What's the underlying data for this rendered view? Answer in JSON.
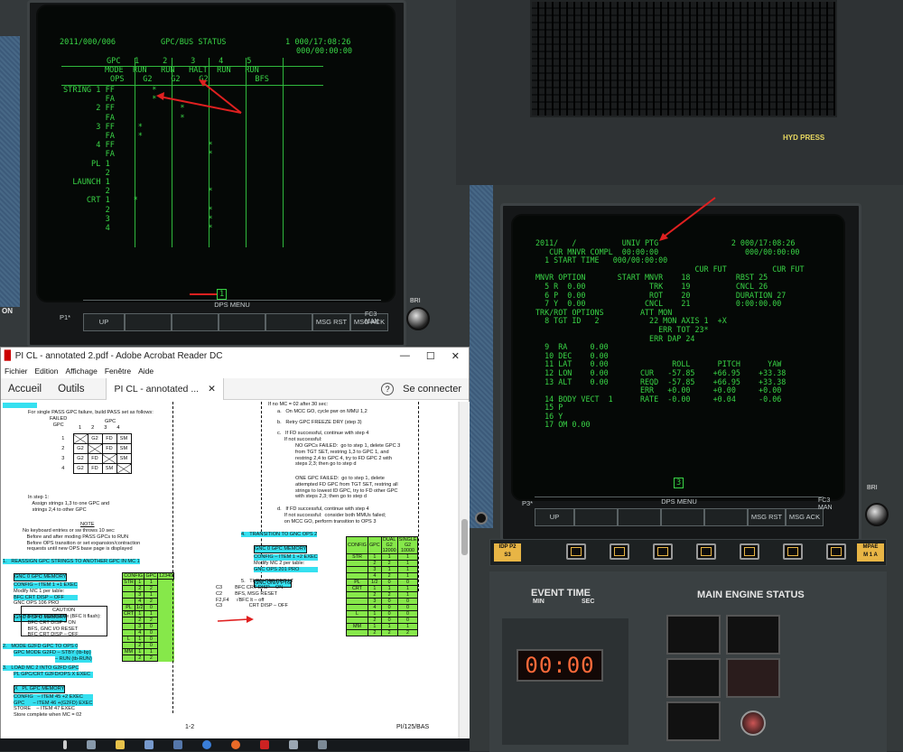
{
  "left_crt": {
    "header_left": "2011/000/006",
    "header_title": "GPC/BUS STATUS",
    "header_right_1": "1 000/17:08:26",
    "header_right_2": "000/00:00:00",
    "gpc_row": "GPC   1     2     3     4     5",
    "mode_row": "MODE  RUN   RUN   HALT  RUN   RUN",
    "ops_row": "OPS    G2    G2    G2          BFS",
    "string_rows": [
      "STRING 1 FF        *",
      "         FA        *",
      "       2 FF              *",
      "         FA              *",
      "       3 FF     *",
      "         FA     *",
      "       4 FF                    *",
      "         FA                    *",
      "",
      "      PL 1",
      "         2",
      "  LAUNCH 1",
      "         2                     *",
      "     CRT 1     *",
      "         2                     *",
      "         3                     *",
      "         4                     *"
    ],
    "page_num": "1",
    "dps_menu": "DPS MENU",
    "p1_label": "P1*",
    "fc_label": "FC3",
    "man_label": "MAN",
    "softkeys": [
      "UP",
      "",
      "",
      "",
      "",
      "MSG RST",
      "MSG ACK"
    ]
  },
  "right_crt": {
    "lines": [
      "2011/   /          UNIV PTG                2 000/17:08:26",
      "   CUR MNVR COMPL  00:00:00                   000/00:00:00",
      "  1 START TIME   000/00:00:00",
      "                                   CUR FUT          CUR FUT",
      "MNVR OPTION       START MNVR    18          RBST 25",
      "  5 R  0.00              TRK    19          CNCL 26",
      "  6 P  0.00              ROT    20          DURATION 27",
      "  7 Y  0.00             CNCL    21          0:00:00.00",
      "",
      "TRK/ROT OPTIONS        ATT MON",
      "  8 TGT ID   2           22 MON AXIS 1  +X",
      "                           ERR TOT 23*",
      "                         ERR DAP 24",
      "  9  RA     0.00",
      "  10 DEC    0.00",
      "  11 LAT    0.00              ROLL      PITCH      YAW",
      "  12 LON    0.00       CUR   -57.85    +66.95    +33.38",
      "  13 ALT    0.00       REQD  -57.85    +66.95    +33.38",
      "                       ERR   +0.00     +0.00     +0.00",
      "  14 BODY VECT  1      RATE  -0.00     +0.04     -0.06",
      "",
      "  15 P",
      "  16 Y",
      "  17 OM 0.00"
    ],
    "page_num": "3",
    "dps_menu": "DPS MENU",
    "p3_label": "P3*",
    "fc_label": "FC3",
    "man_label": "MAN",
    "softkeys": [
      "UP",
      "",
      "",
      "",
      "",
      "MSG RST",
      "MSG ACK"
    ]
  },
  "panel_labels": {
    "hyd_press": "HYD PRESS",
    "bri_top": "BRI",
    "bri_bottom": "BRI",
    "on_label": "ON",
    "idp_label": "IDP P2",
    "idp_sub": "S3",
    "mpa_label": "MPAE",
    "mpa_sub": "M 1 A",
    "event_time": "EVENT TIME",
    "event_min": "MIN",
    "event_sec": "SEC",
    "main_engine_status": "MAIN ENGINE STATUS",
    "timer_value": "00:00"
  },
  "acrobat": {
    "title": "PI CL - annotated 2.pdf - Adobe Acrobat Reader DC",
    "menu": [
      "Fichier",
      "Edition",
      "Affichage",
      "Fenêtre",
      "Aide"
    ],
    "tab_home": "Accueil",
    "tab_tools": "Outils",
    "tab_doc": "PI CL - annotated ...",
    "help_icon_label": "?",
    "connect": "Se connecter",
    "page_footer_center": "1-2",
    "page_footer_right": "PI/125/BAS",
    "left_col": {
      "intro": "For single PASS GPC failure, build PASS set as follows:",
      "failed_gpc": "FAILED\nGPC",
      "gpc_header": "GPC",
      "gpc_cols": [
        "1",
        "2",
        "3",
        "4"
      ],
      "gpc_table": [
        [
          "1",
          "X",
          "G2",
          "FD",
          "SM"
        ],
        [
          "2",
          "G2",
          "X",
          "FD",
          "SM"
        ],
        [
          "3",
          "G2",
          "FD",
          "X",
          "SM"
        ],
        [
          "4",
          "G2",
          "FD",
          "SM",
          "X"
        ]
      ],
      "step1": "In step 1:\n   Assign strings 1,3 to one GPC and\n   strings 2,4 to other GPC",
      "note_title": "NOTE",
      "note_body": "No keyboard entries or sw throws 10 sec:\n   Before and after moding PASS GPCs to RUN\n   Before OPS transition or set expansion/contraction\n   requests until new OPS base page is displayed",
      "s1_title": "1.   REASSIGN GPC STRINGS TO ANOTHER GPC IN MC 1",
      "s1_lines": [
        "GNC 0 GPC MEMORY",
        "CONFIG – ITEM 1 +1 EXEC",
        "Modify MC 1 per table:",
        "BFC CRT DISP – OFF",
        "GNC OPS 106 PRO",
        "GNC 0 GPC MEMORY"
      ],
      "caution_title": "CAUTION",
      "caution_body": "If BFS is standalone (BFC lt flash):\n   BFC CRT DISP – ON\n   BFS, GNC I/O RESET\n   BFC CRT DISP – OFF",
      "s2_title": "2.   MODE G2FD GPC TO OPS 0",
      "s2_lines": [
        "GPC MODE G2FD – STBY (tb-bp)",
        "– RUN (tb-RUN)"
      ],
      "s3_title": "3.   LOAD MC 2 INTO G2FD GPC",
      "s3_lines": [
        "PL GPC/CRT G2FD/OPS X EXEC",
        "X   PL GPC MEMORY",
        "CONFIG   – ITEM 45 +2 EXEC",
        "GPC      – ITEM 46 +(G2FD) EXEC",
        "STORE    – ITEM 47 EXEC",
        "Store complete when MC = 02"
      ],
      "cfg1_header": [
        "CONFIG",
        "GPC",
        "12340"
      ],
      "cfg_rows": [
        [
          "STR",
          "1",
          "1"
        ],
        [
          "",
          "2",
          "2"
        ],
        [
          "",
          "3",
          "1"
        ],
        [
          "",
          "4",
          "2"
        ],
        [
          "PL",
          "1/2",
          "0"
        ],
        [
          "CRT",
          "1",
          "1"
        ],
        [
          "",
          "2",
          "2"
        ],
        [
          "",
          "3",
          "0"
        ],
        [
          "",
          "4",
          "0"
        ],
        [
          "L",
          "1",
          "0"
        ],
        [
          "",
          "2",
          "0"
        ],
        [
          "MM",
          "1",
          "1"
        ],
        [
          "",
          "2",
          "2"
        ]
      ]
    },
    "right_col": {
      "intro": "If no MC = 02 after 30 sec:",
      "a": "a.   On MCC GO, cycle pwr on MMU 1,2",
      "b": "b.   Retry GPC FREEZE DRY (step 3)",
      "c": "c.   If FD successful, continue with step 4\n     If not successful:",
      "c1": "NO GPCs FAILED:  go to step 1, delete GPC 3\nfrom TGT SET, restring 1,3 to GPC 1, and\nrestring 2,4 to GPC 4, try to FD GPC 2 with\nsteps 2,3; then go to step d",
      "c2": "ONE GPC FAILED:  go to step 1, delete\nattempted FD GPC from TGT SET, restring all\nstrings to lowest ID GPC, try to FD other GPC\nwith steps 2,3; then go to step d",
      "d": "d.   If FD successful, continue with step 4\n     If not successful:  consider both MMUs failed;\n     on MCC GO, perform transition to OPS 3",
      "s4_title": "4.   TRANSITION TO GNC OPS 2",
      "s4_lines": [
        "GNC 0 GPC MEMORY",
        "CONFIG – ITEM 1 +2 EXEC",
        "Modify MC 2 per table:",
        "GNC OPS 201 PRO",
        "GNC UNIV PTG"
      ],
      "s5_title": "5.   TURN OFF BFC LT",
      "s5_body": "C3         BFC CRT DISP – ON\nC2         BFS, MSG RESET\nF2,F4     √BFC lt – off\nC3                   CRT DISP – OFF",
      "cfg2_header": [
        "CONFIG",
        "GPC",
        "DUAL\nG2\n12000",
        "SINGLE\nG2\n10000"
      ],
      "cfg2_rows": [
        [
          "STR",
          "1",
          "1",
          "1"
        ],
        [
          "",
          "2",
          "2",
          "1"
        ],
        [
          "",
          "3",
          "1",
          "1"
        ],
        [
          "",
          "4",
          "2",
          "1"
        ],
        [
          "PL",
          "1/2",
          "0",
          "0"
        ],
        [
          "CRT",
          "1",
          "1",
          "1"
        ],
        [
          "",
          "2",
          "2",
          "1"
        ],
        [
          "",
          "3",
          "0",
          "0"
        ],
        [
          "",
          "4",
          "0",
          "0"
        ],
        [
          "L",
          "1",
          "0",
          "0"
        ],
        [
          "",
          "2",
          "0",
          "0"
        ],
        [
          "MM",
          "1",
          "1",
          "1"
        ],
        [
          "",
          "2",
          "2",
          "2"
        ]
      ]
    }
  },
  "colors": {
    "crt_green": "#39d446",
    "annotation_red": "#e02020",
    "highlight_cyan": "#35e0f0",
    "highlight_green": "#86e84a"
  }
}
